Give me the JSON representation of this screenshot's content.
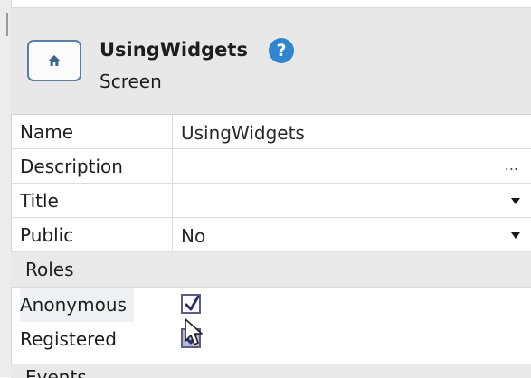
{
  "header": {
    "title": "UsingWidgets",
    "subtitle": "Screen",
    "icon": "home-icon",
    "help_icon": "help-icon"
  },
  "properties": [
    {
      "label": "Name",
      "value": "UsingWidgets",
      "control": "text"
    },
    {
      "label": "Description",
      "value": "",
      "control": "ellipsis",
      "control_text": "..."
    },
    {
      "label": "Title",
      "value": "",
      "control": "dropdown"
    },
    {
      "label": "Public",
      "value": "No",
      "control": "dropdown"
    }
  ],
  "roles_section": {
    "label": "Roles",
    "items": [
      {
        "label": "Anonymous",
        "checked": true
      },
      {
        "label": "Registered",
        "checked": true
      }
    ]
  },
  "next_section": {
    "label": "Events"
  },
  "colors": {
    "header_bg": "#e8e8e8",
    "accent_border": "#5a7fa6",
    "help_blue": "#2f86cf",
    "section_bg": "#e9e9e9",
    "checkbox_border": "#5d5d86",
    "check_color": "#2b2d6e"
  }
}
